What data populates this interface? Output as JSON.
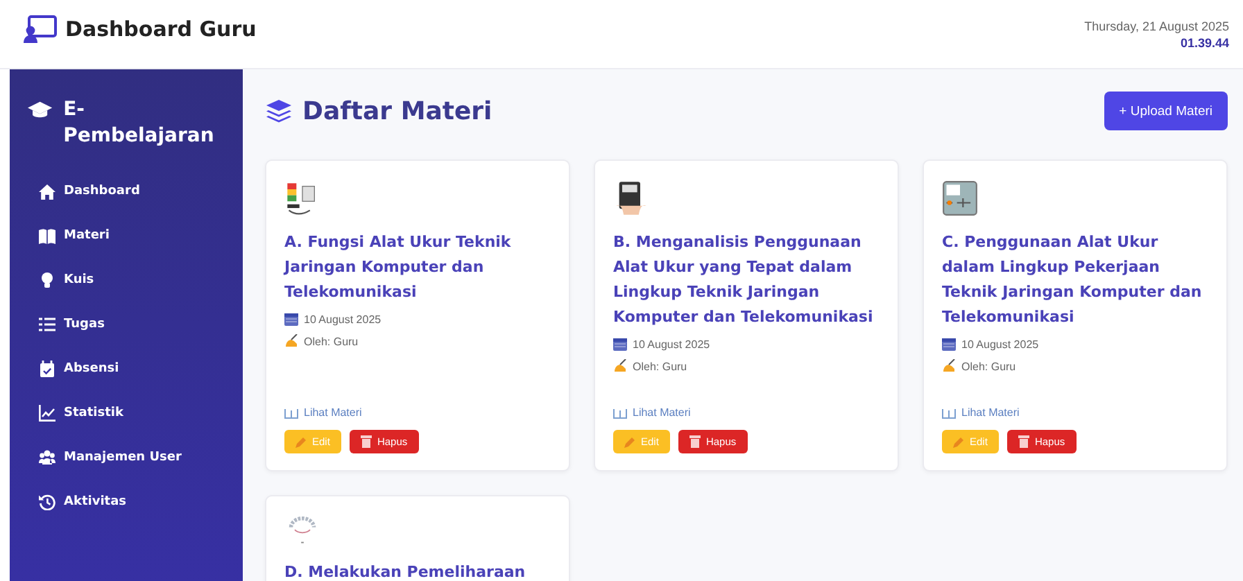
{
  "header": {
    "title": "Dashboard Guru",
    "date": "Thursday, 21 August 2025",
    "time": "01.39.44"
  },
  "sidebar": {
    "brand": "E-Pembelajaran",
    "items": [
      {
        "label": "Dashboard"
      },
      {
        "label": "Materi"
      },
      {
        "label": "Kuis"
      },
      {
        "label": "Tugas"
      },
      {
        "label": "Absensi"
      },
      {
        "label": "Statistik"
      },
      {
        "label": "Manajemen User"
      },
      {
        "label": "Aktivitas"
      }
    ]
  },
  "main": {
    "title": "Daftar Materi",
    "upload_button": "+ Upload Materi",
    "cards": [
      {
        "title": "A. Fungsi Alat Ukur Teknik Jaringan Komputer dan Telekomunikasi",
        "date": "10 August 2025",
        "author": "Oleh: Guru",
        "link": "Lihat Materi",
        "edit": "Edit",
        "delete": "Hapus"
      },
      {
        "title": "B. Menganalisis Penggunaan Alat Ukur yang Tepat dalam Lingkup Teknik Jaringan Komputer dan Telekomunikasi",
        "date": "10 August 2025",
        "author": "Oleh: Guru",
        "link": "Lihat Materi",
        "edit": "Edit",
        "delete": "Hapus"
      },
      {
        "title": "C. Penggunaan Alat Ukur dalam Lingkup Pekerjaan Teknik Jaringan Komputer dan Telekomunikasi",
        "date": "10 August 2025",
        "author": "Oleh: Guru",
        "link": "Lihat Materi",
        "edit": "Edit",
        "delete": "Hapus"
      },
      {
        "title": "D. Melakukan Pemeliharaan"
      }
    ]
  }
}
